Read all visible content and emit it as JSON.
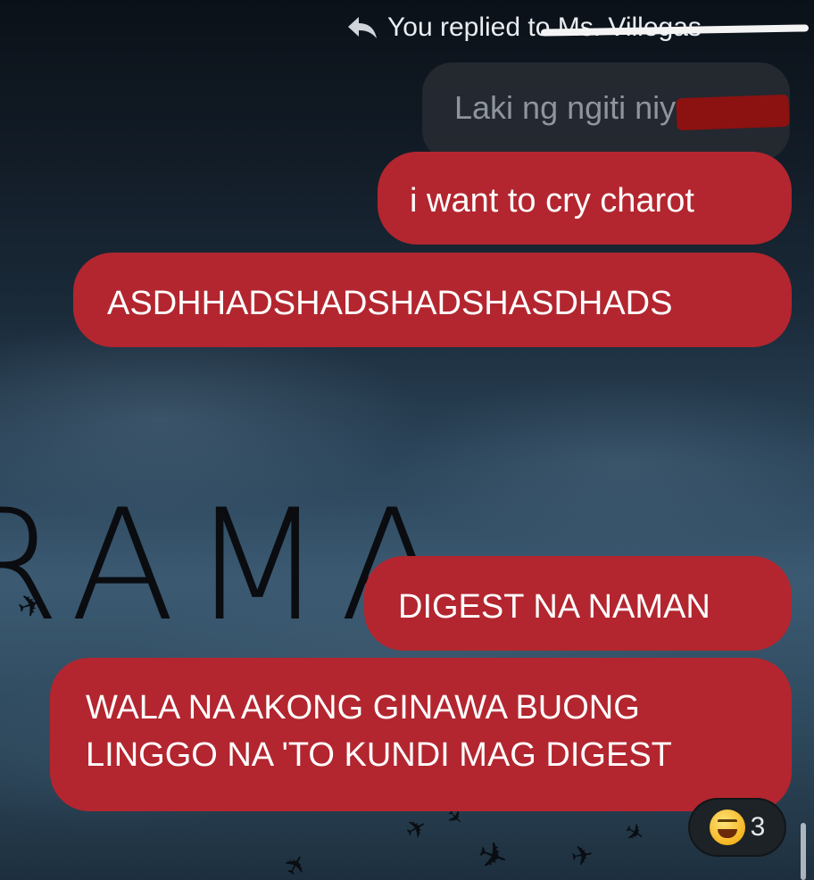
{
  "header": {
    "reply_text": "You replied to Ms. Villegas"
  },
  "quoted_message": {
    "text": "Laki ng ngiti niya"
  },
  "messages": [
    {
      "text": "i want to cry charot"
    },
    {
      "text": "ASDHHADSHADSHADSHASDHADS"
    },
    {
      "text": "DIGEST NA NAMAN"
    },
    {
      "lines": [
        "WALA NA AKONG GINAWA BUONG",
        "LINGGO NA 'TO KUNDI MAG DIGEST"
      ]
    }
  ],
  "background": {
    "word": "RAMA"
  },
  "reaction": {
    "emoji": "laughing-face",
    "count": "3"
  },
  "colors": {
    "bubble": "#b3262f",
    "quoted_bubble": "#282c32",
    "redaction": "#8c1111"
  }
}
